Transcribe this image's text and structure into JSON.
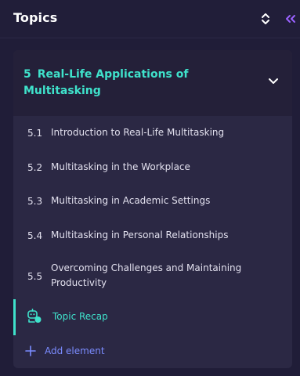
{
  "header": {
    "title": "Topics",
    "sort_icon": "up-down-chevrons-icon",
    "collapse_icon": "double-chevron-left-icon"
  },
  "section": {
    "number": "5",
    "title": "Real-Life Applications of Multitasking",
    "expand_icon": "chevron-down-icon",
    "items": [
      {
        "number": "5.1",
        "label": "Introduction to Real-Life Multitasking"
      },
      {
        "number": "5.2",
        "label": "Multitasking in the Workplace"
      },
      {
        "number": "5.3",
        "label": "Multitasking in Academic Settings"
      },
      {
        "number": "5.4",
        "label": "Multitasking in Personal Relationships"
      },
      {
        "number": "5.5",
        "label": "Overcoming Challenges and Maintaining Productivity"
      }
    ],
    "recap": {
      "label": "Topic Recap",
      "icon": "robot-chat-icon"
    },
    "add": {
      "label": "Add element",
      "icon": "plus-icon"
    }
  },
  "colors": {
    "background": "#201d38",
    "panel": "#2b2844",
    "accent_teal": "#3fe2cb",
    "accent_blue": "#7b8cff",
    "accent_purple": "#9a62ff"
  }
}
